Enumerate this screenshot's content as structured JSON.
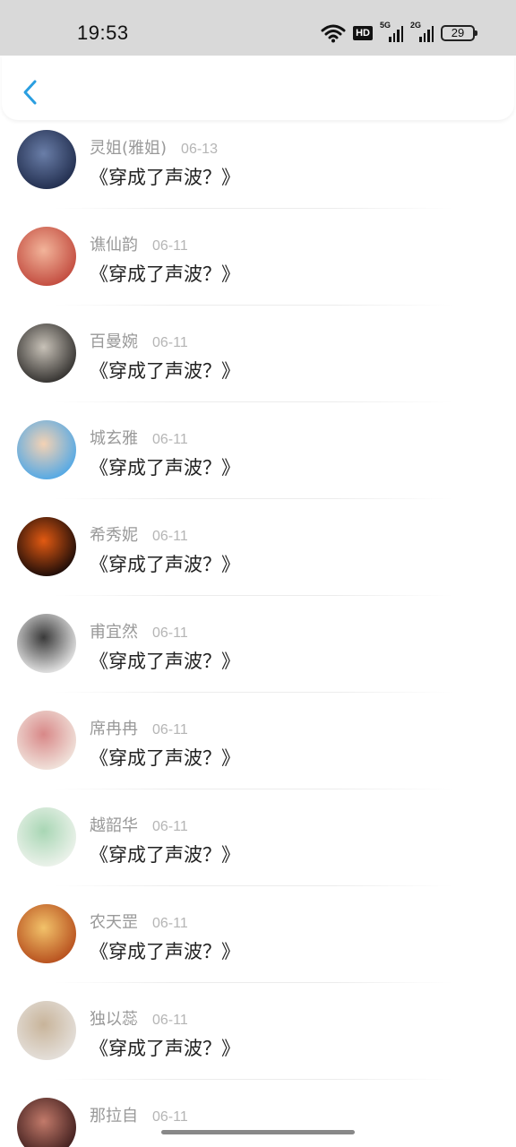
{
  "status_bar": {
    "time": "19:53",
    "hd_label": "HD",
    "sig1_label": "5G",
    "sig2_label": "2G",
    "battery": "29"
  },
  "header": {
    "back_icon": "chevron-left-icon",
    "accent_color": "#2a9ee0"
  },
  "comments": [
    {
      "name": "灵姐(雅姐)",
      "date": "06-13",
      "content": "《穿成了声波？》",
      "avatar_color": [
        "#1e2a4a",
        "#6a7ea8"
      ]
    },
    {
      "name": "谯仙韵",
      "date": "06-11",
      "content": "《穿成了声波？》",
      "avatar_color": [
        "#c0463a",
        "#f2b49a"
      ]
    },
    {
      "name": "百曼婉",
      "date": "06-11",
      "content": "《穿成了声波？》",
      "avatar_color": [
        "#2c2a28",
        "#c8c2b8"
      ]
    },
    {
      "name": "城玄雅",
      "date": "06-11",
      "content": "《穿成了声波？》",
      "avatar_color": [
        "#4aa6e8",
        "#f4d2b4"
      ]
    },
    {
      "name": "希秀妮",
      "date": "06-11",
      "content": "《穿成了声波？》",
      "avatar_color": [
        "#120808",
        "#e25a12"
      ]
    },
    {
      "name": "甫宜然",
      "date": "06-11",
      "content": "《穿成了声波？》",
      "avatar_color": [
        "#ededed",
        "#3a3a3a"
      ]
    },
    {
      "name": "席冉冉",
      "date": "06-11",
      "content": "《穿成了声波？》",
      "avatar_color": [
        "#f2e8e0",
        "#d88888"
      ]
    },
    {
      "name": "越韶华",
      "date": "06-11",
      "content": "《穿成了声波？》",
      "avatar_color": [
        "#f0f4ee",
        "#a8d6b4"
      ]
    },
    {
      "name": "农天罡",
      "date": "06-11",
      "content": "《穿成了声波？》",
      "avatar_color": [
        "#b44a1a",
        "#f2c26a"
      ]
    },
    {
      "name": "独以蕊",
      "date": "06-11",
      "content": "《穿成了声波？》",
      "avatar_color": [
        "#e6e2de",
        "#c8b49a"
      ]
    },
    {
      "name": "那拉自",
      "date": "06-11",
      "content": "",
      "avatar_color": [
        "#3a1a1a",
        "#c27a6a"
      ]
    }
  ]
}
